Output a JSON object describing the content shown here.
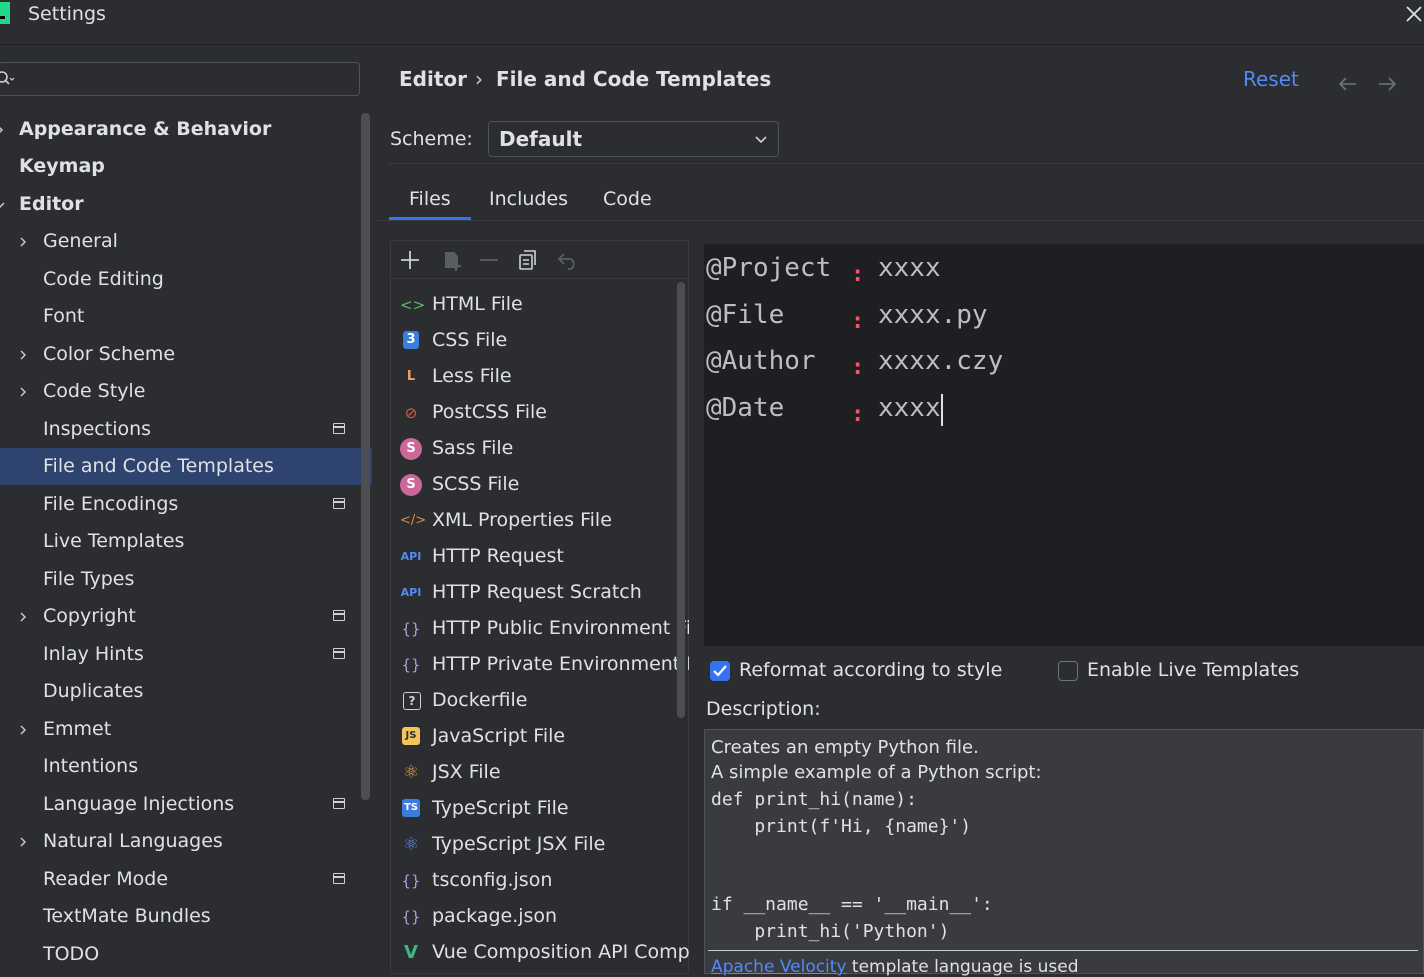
{
  "window": {
    "title": "Settings"
  },
  "search": {
    "value": ""
  },
  "sidebar": {
    "items": [
      {
        "label": "Appearance & Behavior"
      },
      {
        "label": "Keymap"
      },
      {
        "label": "Editor"
      },
      {
        "label": "General"
      },
      {
        "label": "Code Editing"
      },
      {
        "label": "Font"
      },
      {
        "label": "Color Scheme"
      },
      {
        "label": "Code Style"
      },
      {
        "label": "Inspections"
      },
      {
        "label": "File and Code Templates"
      },
      {
        "label": "File Encodings"
      },
      {
        "label": "Live Templates"
      },
      {
        "label": "File Types"
      },
      {
        "label": "Copyright"
      },
      {
        "label": "Inlay Hints"
      },
      {
        "label": "Duplicates"
      },
      {
        "label": "Emmet"
      },
      {
        "label": "Intentions"
      },
      {
        "label": "Language Injections"
      },
      {
        "label": "Natural Languages"
      },
      {
        "label": "Reader Mode"
      },
      {
        "label": "TextMate Bundles"
      },
      {
        "label": "TODO"
      }
    ]
  },
  "breadcrumb": {
    "parent": "Editor",
    "separator": "›",
    "current": "File and Code Templates"
  },
  "header": {
    "reset_label": "Reset"
  },
  "scheme": {
    "label": "Scheme:",
    "value": "Default"
  },
  "tabs": [
    {
      "label": "Files"
    },
    {
      "label": "Includes"
    },
    {
      "label": "Code"
    }
  ],
  "templates": [
    {
      "label": "HTML File",
      "icon": "<>"
    },
    {
      "label": "CSS File",
      "icon": "3"
    },
    {
      "label": "Less File",
      "icon": "L"
    },
    {
      "label": "PostCSS File",
      "icon": "⊘"
    },
    {
      "label": "Sass File",
      "icon": "S"
    },
    {
      "label": "SCSS File",
      "icon": "S"
    },
    {
      "label": "XML Properties File",
      "icon": "</>"
    },
    {
      "label": "HTTP Request",
      "icon": "API"
    },
    {
      "label": "HTTP Request Scratch",
      "icon": "API"
    },
    {
      "label": "HTTP Public Environment File",
      "icon": "{}"
    },
    {
      "label": "HTTP Private Environment File",
      "icon": "{}"
    },
    {
      "label": "Dockerfile",
      "icon": "?"
    },
    {
      "label": "JavaScript File",
      "icon": "JS"
    },
    {
      "label": "JSX File",
      "icon": "⚛"
    },
    {
      "label": "TypeScript File",
      "icon": "TS"
    },
    {
      "label": "TypeScript JSX File",
      "icon": "⚛"
    },
    {
      "label": "tsconfig.json",
      "icon": "{}"
    },
    {
      "label": "package.json",
      "icon": "{}"
    },
    {
      "label": "Vue Composition API Component",
      "icon": "V"
    }
  ],
  "editor": {
    "lines": [
      {
        "key": "@Project",
        "sep": ":",
        "value": "xxxx"
      },
      {
        "key": "@File",
        "sep": ":",
        "value": "xxxx.py"
      },
      {
        "key": "@Author",
        "sep": ":",
        "value": "xxxx.czy"
      },
      {
        "key": "@Date",
        "sep": ":",
        "value": "xxxx"
      }
    ]
  },
  "options": {
    "reformat": {
      "label": "Reformat according to style",
      "checked": true
    },
    "live_templates": {
      "label": "Enable Live Templates",
      "checked": false
    }
  },
  "description": {
    "label": "Description:",
    "line1": "Creates an empty Python file.",
    "line2": "A simple example of a Python script:",
    "code1": "def print_hi(name):",
    "code2": "    print(f'Hi, {name}')",
    "code3": "if __name__ == '__main__':",
    "code4": "    print_hi('Python')",
    "footnote_link": "Apache Velocity",
    "footnote_text": " template language is used"
  },
  "colors": {
    "accent": "#3574f0",
    "link": "#548af7",
    "selection": "#2e436e",
    "editor_bg": "#1e1f22"
  }
}
